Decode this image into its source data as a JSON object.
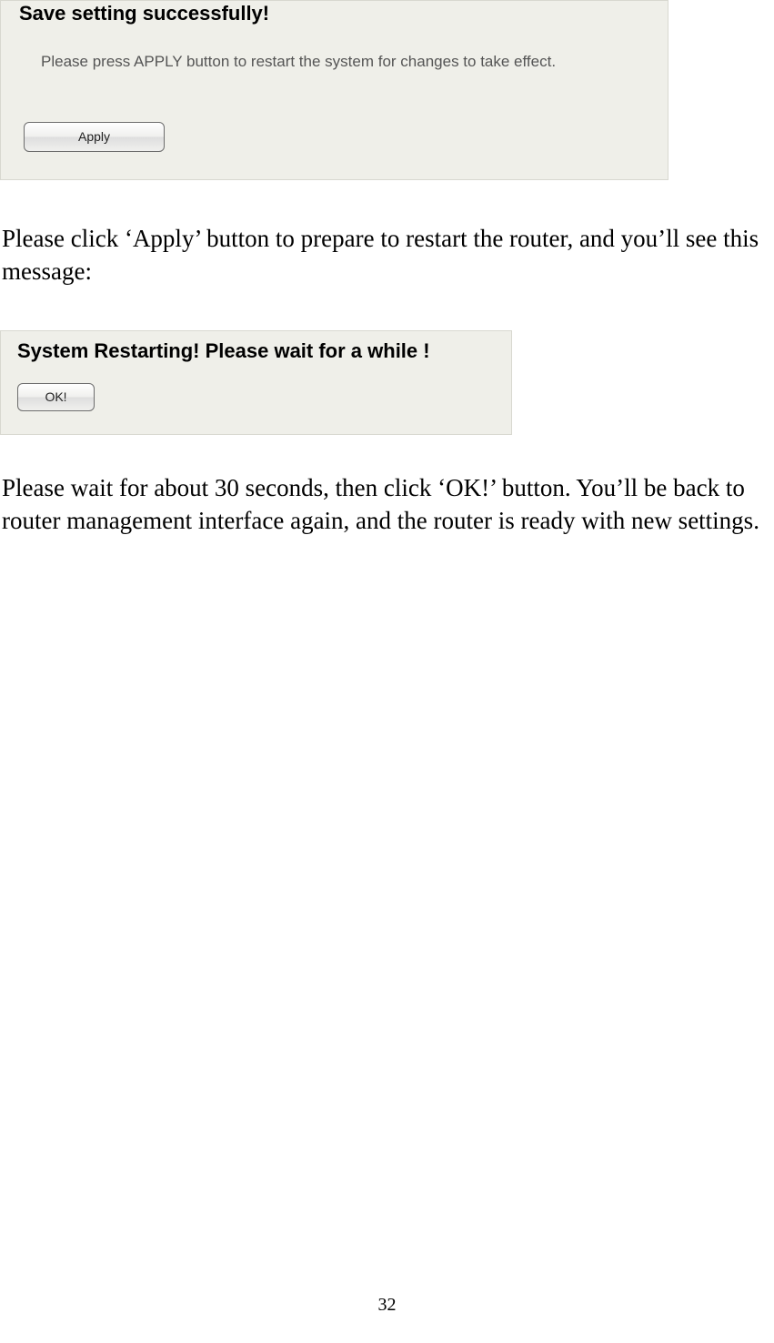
{
  "panel1": {
    "heading": "Save setting successfully!",
    "instruction": "Please press APPLY button to restart the system for changes to take effect.",
    "apply_label": "Apply"
  },
  "body1": "Please click ‘Apply’ button to prepare to restart the router, and you’ll see this message:",
  "panel2": {
    "heading": "System Restarting! Please wait for a while !",
    "ok_label": "OK!"
  },
  "body2": "Please wait for about 30 seconds, then click ‘OK!’ button. You’ll be back to router management interface again, and the router is ready with new settings.",
  "page_number": "32"
}
